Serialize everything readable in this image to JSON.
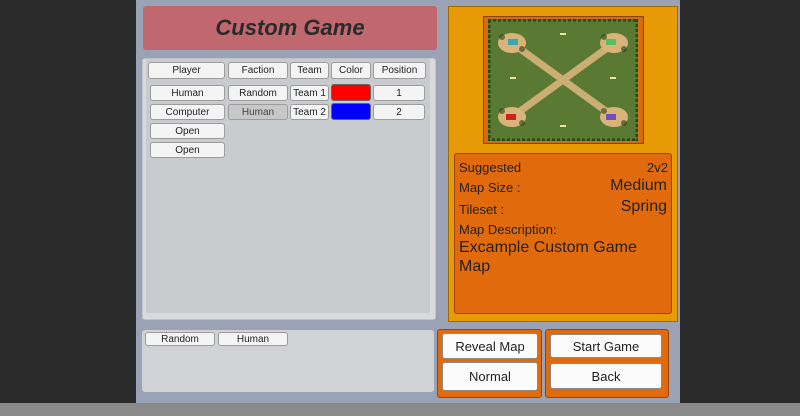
{
  "title": "Custom Game",
  "columns": {
    "player": "Player",
    "faction": "Faction",
    "team": "Team",
    "color": "Color",
    "position": "Position"
  },
  "slots": [
    {
      "player": "Human",
      "faction": "Random",
      "team": "Team 1",
      "color": "#ff0000",
      "position": "1"
    },
    {
      "player": "Computer",
      "faction": "Human",
      "team": "Team 2",
      "color": "#0000ff",
      "position": "2"
    },
    {
      "player": "Open"
    },
    {
      "player": "Open"
    }
  ],
  "defaults": {
    "faction": "Random",
    "race": "Human"
  },
  "map_info": {
    "suggested_label": "Suggested",
    "suggested_value": "2v2",
    "size_label": "Map Size :",
    "size_value": "Medium",
    "tileset_label": "Tileset :",
    "tileset_value": "Spring",
    "description_label": "Map Description:",
    "description_line1": "Excample Custom Game",
    "description_line2": "Map"
  },
  "buttons": {
    "reveal_map": "Reveal Map",
    "difficulty": "Normal",
    "start_game": "Start Game",
    "back": "Back"
  },
  "colors": {
    "panel": "#9aa3b5",
    "title_bg": "#c1676f",
    "accent_orange": "#e06a0c",
    "preview_bg": "#e89a06"
  }
}
